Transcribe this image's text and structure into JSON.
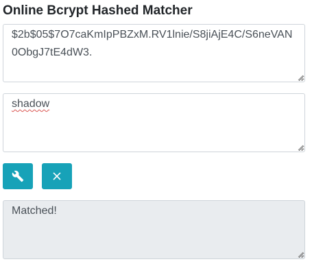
{
  "page": {
    "title": "Online Bcrypt Hashed Matcher"
  },
  "hash_input": {
    "value": "$2b$05$7O7caKmIpPBZxM.RV1lnie/S8jiAjE4C/S6neVAN0ObgJ7tE4dW3."
  },
  "plain_input": {
    "value": "shadow"
  },
  "actions": {
    "match_icon": "wrench-icon",
    "clear_icon": "close-icon"
  },
  "result": {
    "value": "Matched!"
  },
  "colors": {
    "button": "#17a2b8",
    "result_background": "#e9ecef",
    "border": "#ced4da"
  }
}
